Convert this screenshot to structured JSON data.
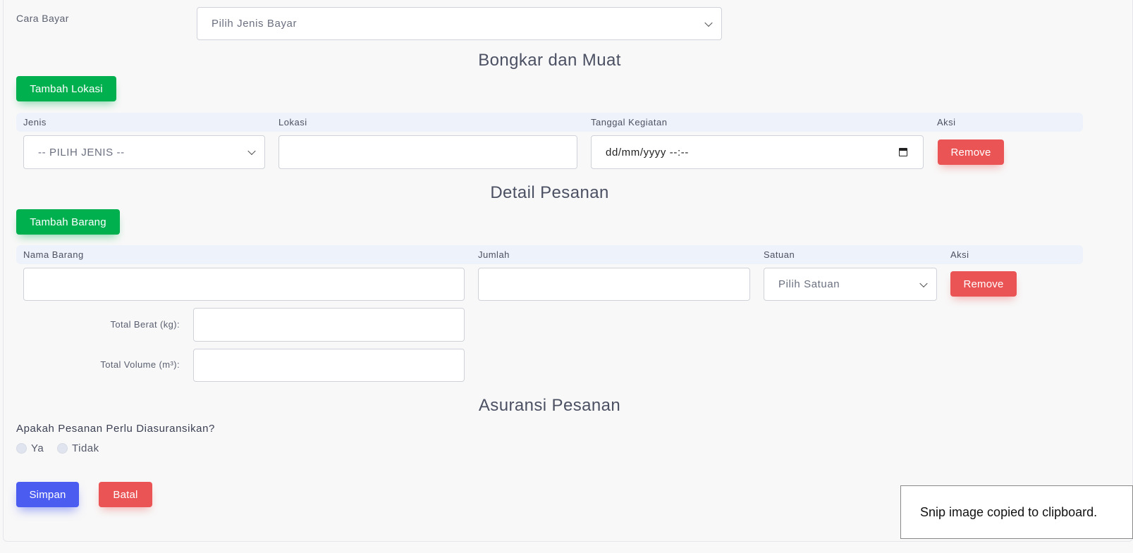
{
  "payment": {
    "label": "Cara Bayar",
    "placeholder": "Pilih Jenis Bayar"
  },
  "loading_section": {
    "title": "Bongkar dan Muat",
    "add_button": "Tambah Lokasi",
    "columns": [
      "Jenis",
      "Lokasi",
      "Tanggal Kegiatan",
      "Aksi"
    ],
    "row": {
      "jenis_value": "-- PILIH JENIS --",
      "lokasi_value": "",
      "tanggal_value": "dd/mm/yyyy --:--",
      "remove_label": "Remove"
    }
  },
  "order_section": {
    "title": "Detail Pesanan",
    "add_button": "Tambah Barang",
    "columns": [
      "Nama Barang",
      "Jumlah",
      "Satuan",
      "Aksi"
    ],
    "row": {
      "nama_value": "",
      "jumlah_value": "",
      "satuan_value": "Pilih Satuan",
      "remove_label": "Remove"
    },
    "total_berat_label": "Total Berat (kg):",
    "total_volume_label": "Total Volume (m³):"
  },
  "insurance_section": {
    "title": "Asuransi Pesanan",
    "question": "Apakah Pesanan Perlu Diasuransikan?",
    "options": [
      "Ya",
      "Tidak"
    ]
  },
  "actions": {
    "save": "Simpan",
    "cancel": "Batal"
  },
  "toast": {
    "message": "Snip image copied to clipboard."
  }
}
